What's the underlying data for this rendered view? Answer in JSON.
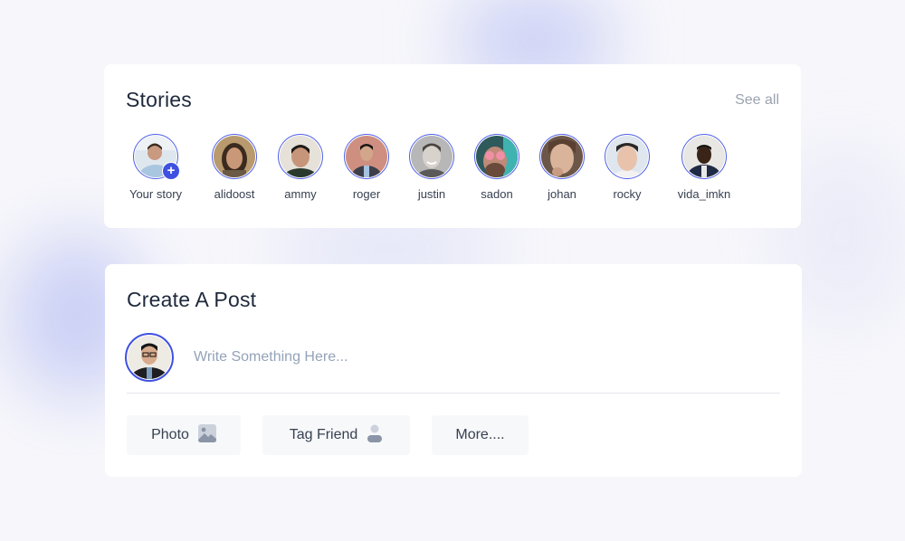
{
  "stories": {
    "title": "Stories",
    "see_all_label": "See all",
    "items": [
      {
        "label": "Your story",
        "is_own": true,
        "add_icon": "+"
      },
      {
        "label": "alidoost"
      },
      {
        "label": "ammy"
      },
      {
        "label": "roger"
      },
      {
        "label": "justin"
      },
      {
        "label": "sadon"
      },
      {
        "label": "johan"
      },
      {
        "label": "rocky"
      },
      {
        "label": "vida_imkn"
      }
    ]
  },
  "create_post": {
    "title": "Create A Post",
    "input_placeholder": "Write Something Here...",
    "input_value": "",
    "actions": [
      {
        "label": "Photo",
        "icon": "image-icon"
      },
      {
        "label": "Tag Friend",
        "icon": "user-icon"
      },
      {
        "label": "More...."
      }
    ]
  },
  "colors": {
    "accent": "#3f51e0",
    "title": "#1e293b",
    "muted": "#9ca3af",
    "button_bg": "#f7f8fa"
  }
}
